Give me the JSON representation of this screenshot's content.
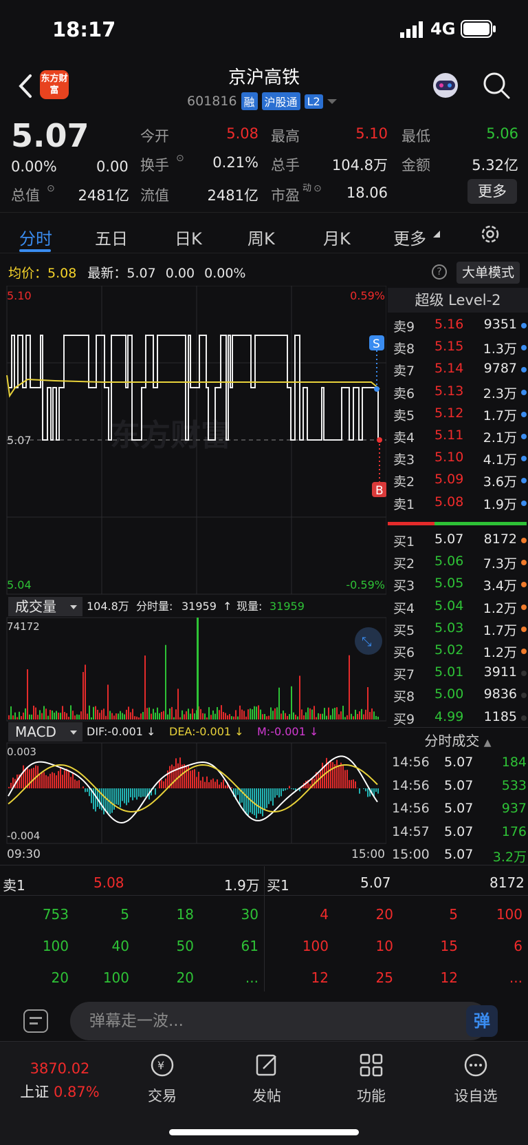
{
  "status_bar": {
    "time": "18:17",
    "network": "4G"
  },
  "header": {
    "logo_text": "东方财富",
    "title": "京沪高铁",
    "code": "601816",
    "tags": [
      "融",
      "沪股通",
      "L2"
    ]
  },
  "quote": {
    "price": "5.07",
    "change_pct": "0.00%",
    "change": "0.00",
    "open_label": "今开",
    "open": "5.08",
    "high_label": "最高",
    "high": "5.10",
    "low_label": "最低",
    "low": "5.06",
    "turnover_label": "换手",
    "turnover": "0.21%",
    "volume_label": "总手",
    "volume": "104.8万",
    "amount_label": "金额",
    "amount": "5.32亿",
    "mktcap_label": "总值",
    "mktcap": "2481亿",
    "float_label": "流值",
    "float": "2481亿",
    "pe_label": "市盈",
    "pe_super": "动",
    "pe": "18.06",
    "more_label": "更多"
  },
  "tabs": [
    "分时",
    "五日",
    "日K",
    "周K",
    "月K",
    "更多"
  ],
  "chart_header": {
    "avg_label": "均价：",
    "avg": "5.08",
    "latest_label": "最新：",
    "latest": "5.07",
    "latest_chg": "0.00",
    "latest_pct": "0.00%",
    "help": "?",
    "bigorder_label": "大单模式"
  },
  "chart_data": [
    {
      "type": "line",
      "title": "分时",
      "ylim": [
        5.04,
        5.1
      ],
      "y_top_label": "5.10",
      "y_mid_label": "5.07",
      "y_bottom_label": "5.04",
      "pct_top_label": "0.59%",
      "pct_bottom_label": "-0.59%",
      "watermark": "东方财富",
      "markers": [
        "S",
        "B"
      ]
    },
    {
      "type": "bar",
      "title": "成交量",
      "summary": "104.8万",
      "period_label": "分时量:",
      "period_vol": "31959",
      "now_label": "现量:",
      "now_vol": "31959",
      "y_max_label": "74172"
    },
    {
      "type": "bar",
      "title": "MACD",
      "dif_label": "DIF:-0.001 ↓",
      "dea_label": "DEA:-0.001 ↓",
      "m_label": "M:-0.001 ↓",
      "y_top_label": "0.003",
      "y_bottom_label": "-0.004",
      "x_start": "09:30",
      "x_end": "15:00"
    }
  ],
  "order_book": {
    "title": "超级 Level-2",
    "asks": [
      {
        "label": "卖9",
        "price": "5.16",
        "vol": "9351"
      },
      {
        "label": "卖8",
        "price": "5.15",
        "vol": "1.3万"
      },
      {
        "label": "卖7",
        "price": "5.14",
        "vol": "9787"
      },
      {
        "label": "卖6",
        "price": "5.13",
        "vol": "2.3万"
      },
      {
        "label": "卖5",
        "price": "5.12",
        "vol": "1.7万"
      },
      {
        "label": "卖4",
        "price": "5.11",
        "vol": "2.1万"
      },
      {
        "label": "卖3",
        "price": "5.10",
        "vol": "4.1万"
      },
      {
        "label": "卖2",
        "price": "5.09",
        "vol": "3.6万"
      },
      {
        "label": "卖1",
        "price": "5.08",
        "vol": "1.9万"
      }
    ],
    "bids": [
      {
        "label": "买1",
        "price": "5.07",
        "vol": "8172"
      },
      {
        "label": "买2",
        "price": "5.06",
        "vol": "7.3万"
      },
      {
        "label": "买3",
        "price": "5.05",
        "vol": "3.4万"
      },
      {
        "label": "买4",
        "price": "5.04",
        "vol": "1.2万"
      },
      {
        "label": "买5",
        "price": "5.03",
        "vol": "1.7万"
      },
      {
        "label": "买6",
        "price": "5.02",
        "vol": "1.2万"
      },
      {
        "label": "买7",
        "price": "5.01",
        "vol": "3911"
      },
      {
        "label": "买8",
        "price": "5.00",
        "vol": "9836"
      },
      {
        "label": "买9",
        "price": "4.99",
        "vol": "1185"
      }
    ]
  },
  "ticks": {
    "title": "分时成交",
    "rows": [
      {
        "time": "14:56",
        "price": "5.07",
        "vol": "184"
      },
      {
        "time": "14:56",
        "price": "5.07",
        "vol": "533"
      },
      {
        "time": "14:56",
        "price": "5.07",
        "vol": "937"
      },
      {
        "time": "14:57",
        "price": "5.07",
        "vol": "176"
      },
      {
        "time": "15:00",
        "price": "5.07",
        "vol": "3.2万"
      }
    ]
  },
  "queue": {
    "sell_label": "卖1",
    "sell_price": "5.08",
    "sell_vol": "1.9万",
    "buy_label": "买1",
    "buy_price": "5.07",
    "buy_vol": "8172",
    "sell_cells": [
      "753",
      "5",
      "18",
      "30",
      "100",
      "40",
      "50",
      "61",
      "20",
      "100",
      "20",
      "..."
    ],
    "buy_cells": [
      "4",
      "20",
      "5",
      "100",
      "100",
      "10",
      "15",
      "6",
      "12",
      "25",
      "12",
      "..."
    ]
  },
  "comment": {
    "placeholder": "弹幕走一波...",
    "danmu_btn": "弹"
  },
  "bottom_nav": {
    "index_value": "3870.02",
    "index_name": "上证",
    "index_pct": "0.87%",
    "items": [
      "交易",
      "发帖",
      "功能",
      "设自选"
    ]
  }
}
